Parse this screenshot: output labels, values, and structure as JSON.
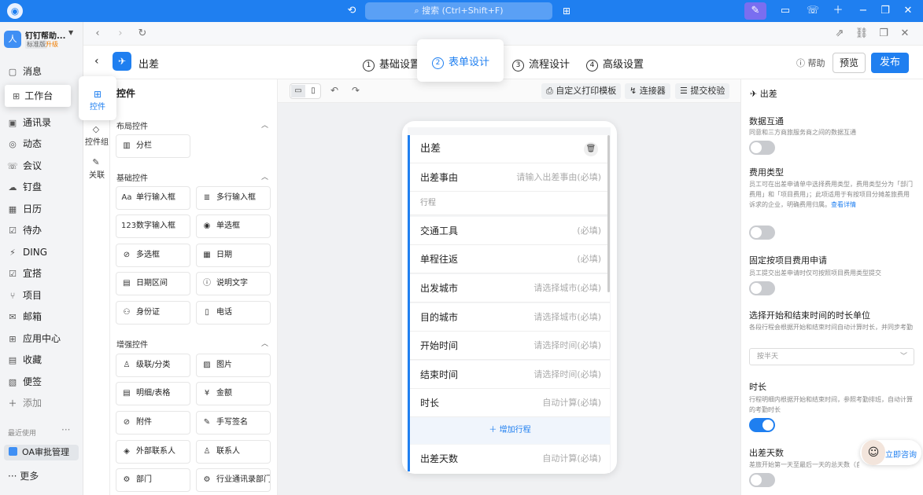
{
  "titlebar": {
    "search_placeholder": "搜索 (Ctrl+Shift+F)",
    "icons": [
      "history-icon",
      "search-icon",
      "apps-grid-icon",
      "ai-icon",
      "screen-icon",
      "phone-icon",
      "plus-icon",
      "minimize-icon",
      "restore-icon",
      "close-icon"
    ]
  },
  "sidebar": {
    "org_name": "钉钉帮助...",
    "org_badge": "标准版",
    "org_upgrade": "升级",
    "items": [
      {
        "label": "消息",
        "icon": "message-icon"
      },
      {
        "label": "工作台",
        "icon": "workbench-icon"
      },
      {
        "label": "通讯录",
        "icon": "contacts-icon"
      },
      {
        "label": "动态",
        "icon": "moments-icon"
      },
      {
        "label": "会议",
        "icon": "meeting-icon"
      },
      {
        "label": "钉盘",
        "icon": "cloud-icon"
      },
      {
        "label": "日历",
        "icon": "calendar-icon"
      },
      {
        "label": "待办",
        "icon": "todo-icon"
      },
      {
        "label": "DING",
        "icon": "ding-icon"
      },
      {
        "label": "宜搭",
        "icon": "yida-icon"
      },
      {
        "label": "项目",
        "icon": "project-icon"
      },
      {
        "label": "邮箱",
        "icon": "mail-icon"
      },
      {
        "label": "应用中心",
        "icon": "app-center-icon"
      },
      {
        "label": "收藏",
        "icon": "favorite-icon"
      },
      {
        "label": "便签",
        "icon": "note-icon"
      },
      {
        "label": "添加",
        "icon": "add-icon"
      }
    ],
    "recent_label": "最近使用",
    "recent_app": "OA审批管理",
    "more": "更多"
  },
  "header": {
    "form_title": "出差",
    "steps": [
      {
        "num": "1",
        "label": "基础设置"
      },
      {
        "num": "2",
        "label": "表单设计"
      },
      {
        "num": "3",
        "label": "流程设计"
      },
      {
        "num": "4",
        "label": "高级设置"
      }
    ],
    "help": "帮助",
    "preview": "预览",
    "publish": "发布"
  },
  "rail": {
    "controls": "控件",
    "groups": "控件组",
    "relation": "关联"
  },
  "palette": {
    "title": "控件",
    "groups": [
      {
        "name": "布局控件",
        "items": [
          {
            "label": "分栏",
            "icon": "columns-icon"
          }
        ]
      },
      {
        "name": "基础控件",
        "items": [
          {
            "label": "单行输入框",
            "icon": "single-line-icon"
          },
          {
            "label": "多行输入框",
            "icon": "multi-line-icon"
          },
          {
            "label": "数字输入框",
            "icon": "number-icon"
          },
          {
            "label": "单选框",
            "icon": "radio-icon"
          },
          {
            "label": "多选框",
            "icon": "checkbox-icon"
          },
          {
            "label": "日期",
            "icon": "date-icon"
          },
          {
            "label": "日期区间",
            "icon": "date-range-icon"
          },
          {
            "label": "说明文字",
            "icon": "info-icon"
          },
          {
            "label": "身份证",
            "icon": "id-card-icon"
          },
          {
            "label": "电话",
            "icon": "phone-icon"
          }
        ]
      },
      {
        "name": "增强控件",
        "items": [
          {
            "label": "级联/分类",
            "icon": "cascade-icon"
          },
          {
            "label": "图片",
            "icon": "image-icon"
          },
          {
            "label": "明细/表格",
            "icon": "table-icon"
          },
          {
            "label": "金额",
            "icon": "money-icon"
          },
          {
            "label": "附件",
            "icon": "attachment-icon"
          },
          {
            "label": "手写签名",
            "icon": "signature-icon"
          },
          {
            "label": "外部联系人",
            "icon": "external-contact-icon"
          },
          {
            "label": "联系人",
            "icon": "contact-icon"
          },
          {
            "label": "部门",
            "icon": "department-icon"
          },
          {
            "label": "行业通讯录部门",
            "icon": "industry-dept-icon"
          }
        ]
      }
    ]
  },
  "canvas": {
    "print_template": "自定义打印模板",
    "connector": "连接器",
    "submit_check": "提交校验",
    "add_trip": "增加行程",
    "fields": [
      {
        "label": "出差",
        "placeholder": ""
      },
      {
        "label": "出差事由",
        "placeholder": "请输入出差事由(必填)"
      },
      {
        "label": "行程",
        "placeholder": ""
      },
      {
        "label": "交通工具",
        "placeholder": "(必填)"
      },
      {
        "label": "单程往返",
        "placeholder": "(必填)"
      },
      {
        "label": "出发城市",
        "placeholder": "请选择城市(必填)"
      },
      {
        "label": "目的城市",
        "placeholder": "请选择城市(必填)"
      },
      {
        "label": "开始时间",
        "placeholder": "请选择时间(必填)"
      },
      {
        "label": "结束时间",
        "placeholder": "请选择时间(必填)"
      },
      {
        "label": "时长",
        "placeholder": "自动计算(必填)"
      },
      {
        "label": "出差天数",
        "placeholder": "自动计算(必填)"
      }
    ]
  },
  "panel": {
    "title": "出差",
    "settings": [
      {
        "label": "数据互通",
        "desc": "同意和三方商旅服务商之间的数据互通",
        "on": false
      },
      {
        "label": "费用类型",
        "desc": "员工可在出差申请单中选择费用类型，费用类型分为「部门费用」和「项目费用」；此项适用于有按项目分摊差旅费用诉求的企业，明确费用归属。",
        "link": "查看详情",
        "on": false
      },
      {
        "label": "固定按项目费用申请",
        "desc": "员工提交出差申请时仅可按照项目费用类型提交",
        "on": false
      },
      {
        "label": "选择开始和结束时间的时长单位",
        "desc": "各段行程会根据开始和结束时间自动计算时长，并同步考勤",
        "select": "按半天"
      },
      {
        "label": "时长",
        "desc": "行程明细内根据开始和结束时间，参照考勤排班，自动计算的考勤时长",
        "on": true
      },
      {
        "label": "出差天数",
        "desc": "差旅开始第一天至最后一天的总天数（自然日）",
        "on": false
      }
    ],
    "consult": "立即咨询"
  },
  "colors": {
    "accent": "#1f7ff0",
    "titlebar": "#1f7ff0"
  }
}
